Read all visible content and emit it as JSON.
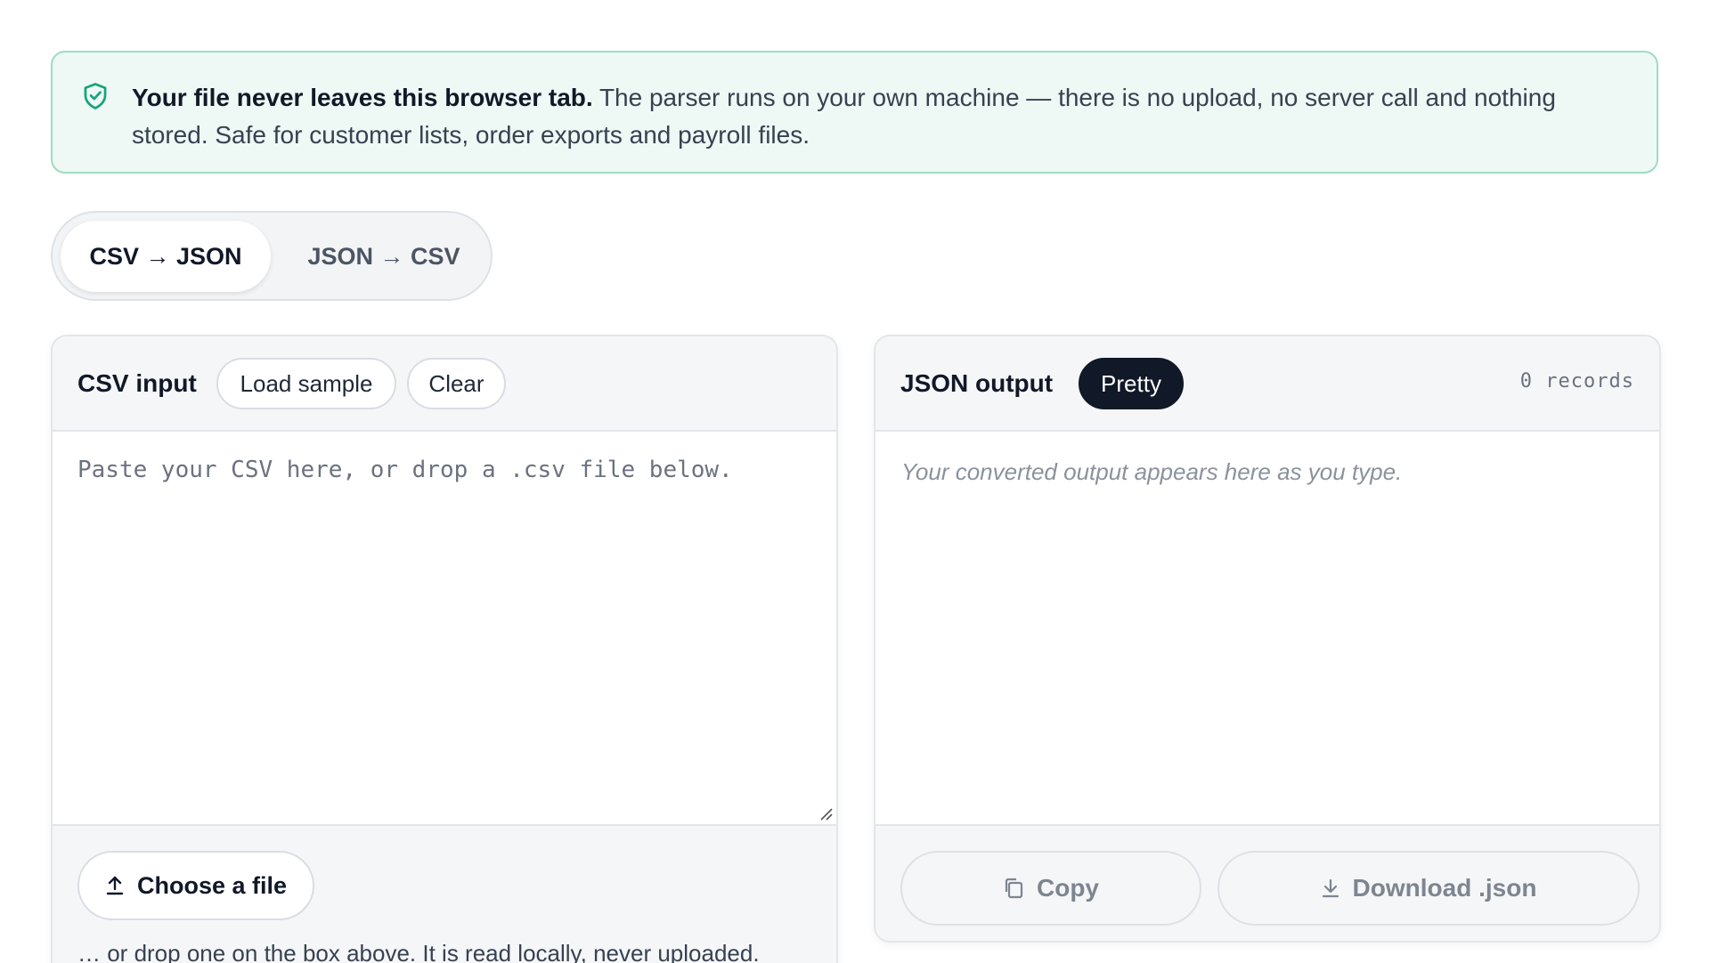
{
  "banner": {
    "bold": "Your file never leaves this browser tab.",
    "text": " The parser runs on your own machine — there is no upload, no server call and nothing stored. Safe for customer lists, order exports and payroll files."
  },
  "mode_toggle": {
    "active": "CSV → JSON",
    "inactive": "JSON → CSV"
  },
  "input_panel": {
    "title": "CSV input",
    "load_sample": "Load sample",
    "clear": "Clear",
    "placeholder": "Paste your CSV here, or drop a .csv file below.",
    "value": "",
    "choose_file": "Choose a file",
    "drop_note": "… or drop one on the box above. It is read locally, never uploaded."
  },
  "output_panel": {
    "title": "JSON output",
    "format_label": "Pretty",
    "records": "0 records",
    "placeholder": "Your converted output appears here as you type.",
    "copy": "Copy",
    "download": "Download .json"
  },
  "colors": {
    "banner_bg": "#eef8f4",
    "banner_border": "#9fdcc3",
    "shield": "#16a37b",
    "dark_pill": "#111827"
  },
  "icons": [
    "shield-check-icon",
    "upload-icon",
    "copy-icon",
    "download-icon",
    "resize-grip-icon"
  ]
}
